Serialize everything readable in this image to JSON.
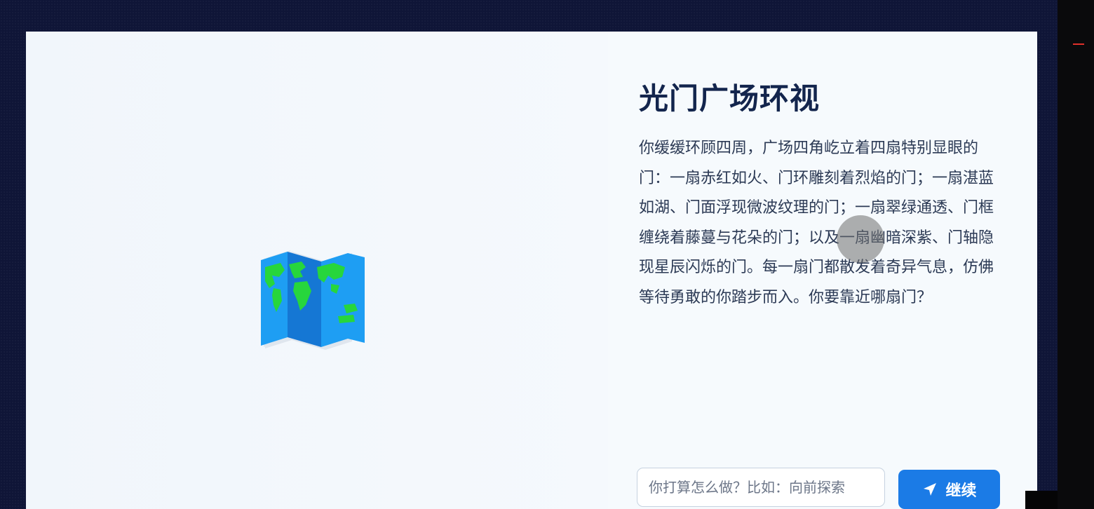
{
  "scene": {
    "title": "光门广场环视",
    "description": "你缓缓环顾四周，广场四角屹立着四扇特别显眼的门：一扇赤红如火、门环雕刻着烈焰的门；一扇湛蓝如湖、门面浮现微波纹理的门；一扇翠绿通透、门框缠绕着藤蔓与花朵的门；以及一扇幽暗深紫、门轴隐现星辰闪烁的门。每一扇门都散发着奇异气息，仿佛等待勇敢的你踏步而入。你要靠近哪扇门？",
    "image_icon": "world-map-icon"
  },
  "action_input": {
    "placeholder": "你打算怎么做？比如：向前探索",
    "value": ""
  },
  "send_button": {
    "label": "继续",
    "icon": "paper-plane-icon"
  },
  "colors": {
    "accent": "#1b7be6",
    "title": "#13254d",
    "text": "#2c3a55",
    "panel": "#f3f8fc",
    "backdrop": "#0f1537"
  }
}
